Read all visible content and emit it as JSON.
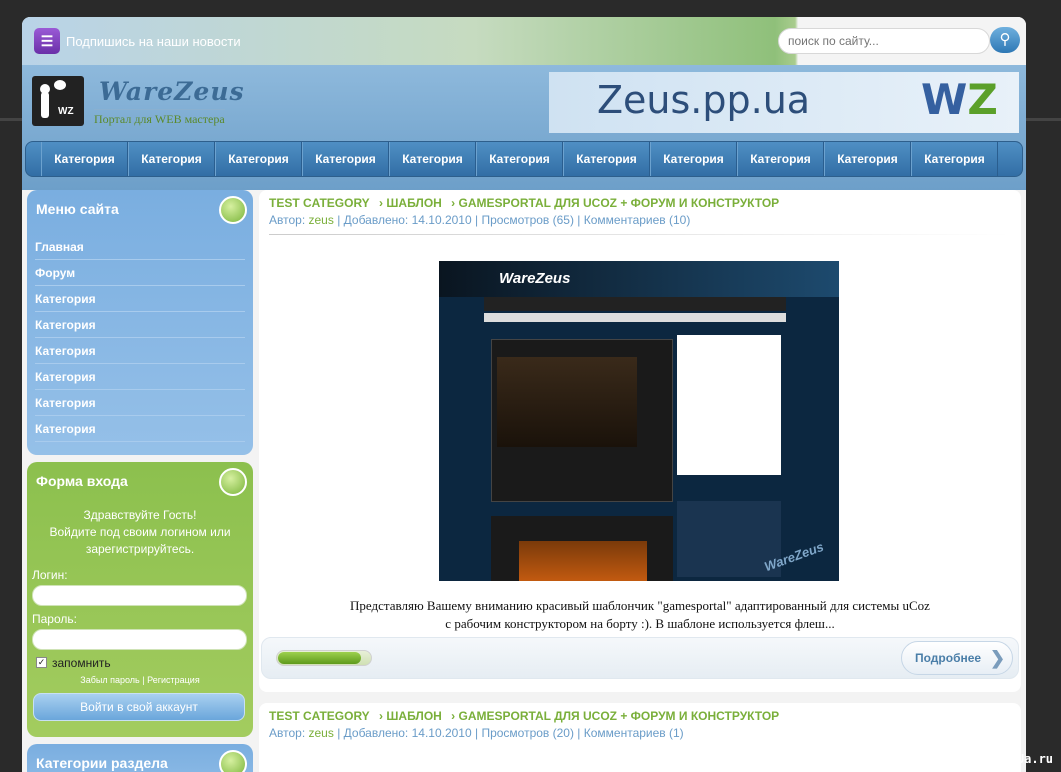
{
  "topbar": {
    "subscribe": "Подпишись на наши новости",
    "search_placeholder": "поиск по сайту..."
  },
  "header": {
    "site_title": "WareZeus",
    "site_subtitle": "Портал для WEB мастера",
    "banner_text": "Zeus.pp.ua",
    "banner_logo_w": "W",
    "banner_logo_z": "Z"
  },
  "nav": [
    "Категория",
    "Категория",
    "Категория",
    "Категория",
    "Категория",
    "Категория",
    "Категория",
    "Категория",
    "Категория",
    "Категория",
    "Категория"
  ],
  "menu": {
    "title": "Меню сайта",
    "items": [
      "Главная",
      "Форум",
      "Категория",
      "Категория",
      "Категория",
      "Категория",
      "Категория",
      "Категория"
    ]
  },
  "login": {
    "title": "Форма входа",
    "greeting1": "Здравствуйте Гость!",
    "greeting2": "Войдите под своим логином или",
    "greeting3": "зарегистрируйтесь.",
    "login_label": "Логин:",
    "password_label": "Пароль:",
    "remember_label": "запомнить",
    "forgot": "Забыл пароль",
    "divider": "|",
    "register": "Регистрация",
    "button": "Войти в свой аккаунт"
  },
  "categories": {
    "title": "Категории раздела"
  },
  "posts": [
    {
      "crumbs": [
        "TEST CATEGORY",
        "› ШАБЛОН",
        "› GAMESPORTAL ДЛЯ UCOZ + ФОРУМ И КОНСТРУКТОР"
      ],
      "meta_prefix": "Автор: ",
      "author": "zeus",
      "meta_rest": " | Добавлено: 14.10.2010 | Просмотров (65) | Комментариев (10)",
      "desc1": "Представляю Вашему вниманию красивый шаблончик \"gamesportal\" адаптированный для системы uCoz",
      "desc2": "с рабочим конструктором на борту :). В шаблоне используется флеш...",
      "more": "Подробнее",
      "rating": 0.9
    },
    {
      "crumbs": [
        "TEST CATEGORY",
        "› ШАБЛОН",
        "› GAMESPORTAL ДЛЯ UCOZ + ФОРУМ И КОНСТРУКТОР"
      ],
      "meta_prefix": "Автор: ",
      "author": "zeus",
      "meta_rest": " | Добавлено: 14.10.2010 | Просмотров (20) | Комментариев (1)"
    }
  ],
  "screenshot": {
    "logo": "WareZeus",
    "watermark": "WareZeus"
  },
  "watermark": "UcozUa.ru"
}
